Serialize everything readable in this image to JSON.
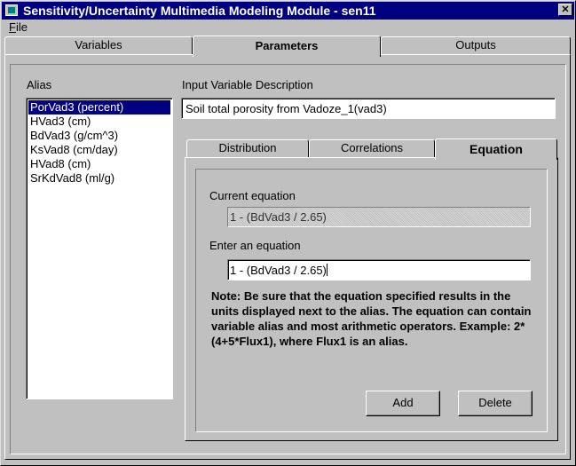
{
  "window": {
    "title": "Sensitivity/Uncertainty Multimedia Modeling Module - sen11",
    "close_glyph": "✕"
  },
  "menu": {
    "file_letter": "F",
    "file_rest": "ile"
  },
  "main_tabs": {
    "variables": "Variables",
    "parameters": "Parameters",
    "outputs": "Outputs",
    "active": "parameters"
  },
  "alias": {
    "label": "Alias",
    "items": [
      "PorVad3 (percent)",
      "HVad3 (cm)",
      "BdVad3 (g/cm^3)",
      "KsVad8 (cm/day)",
      "HVad8 (cm)",
      "SrKdVad8 (ml/g)"
    ],
    "selected_index": 0
  },
  "description": {
    "label": "Input Variable Description",
    "value": "Soil total porosity from Vadoze_1(vad3)"
  },
  "sub_tabs": {
    "distribution": "Distribution",
    "correlations": "Correlations",
    "equation": "Equation",
    "active": "equation"
  },
  "equation": {
    "current_label": "Current equation",
    "current_value": "1 - (BdVad3 / 2.65)",
    "enter_label": "Enter an equation",
    "enter_value": "1 - (BdVad3 / 2.65)",
    "note": "Note: Be sure that the equation specified results in the units displayed next to the alias.  The equation can contain variable alias and most arithmetic operators.  Example: 2*(4+5*Flux1), where Flux1 is an alias.",
    "add_label": "Add",
    "delete_label": "Delete"
  },
  "colors": {
    "face": "#c0c0c0",
    "titlebar": "#000080",
    "selection": "#000080"
  }
}
